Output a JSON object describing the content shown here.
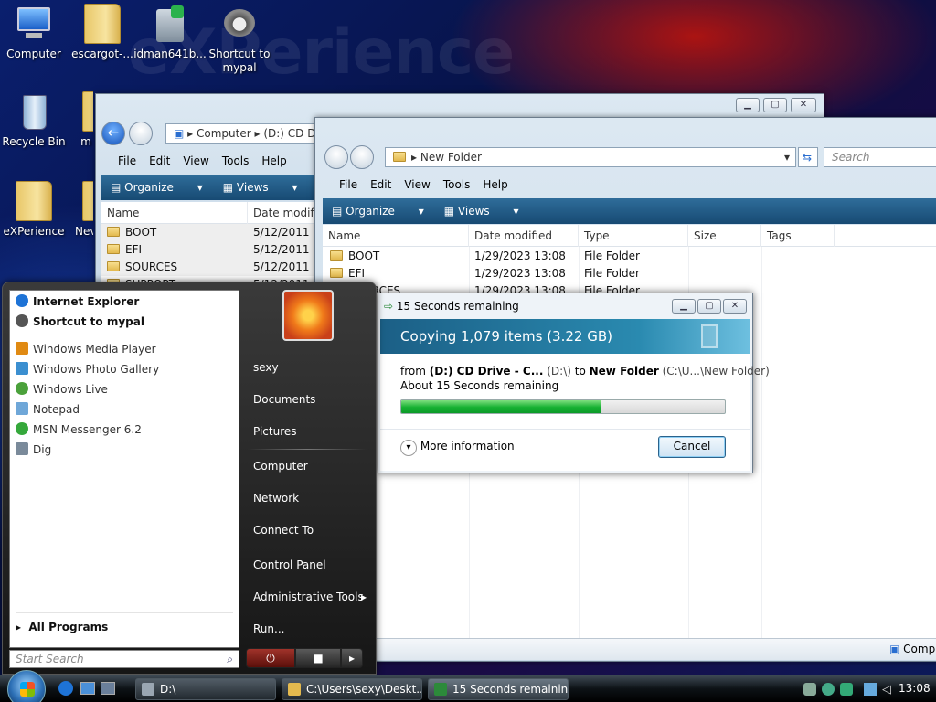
{
  "desktop": {
    "watermark": "eXPerience",
    "icons": [
      {
        "label": "Computer",
        "icon": "computer-icon"
      },
      {
        "label": "escargot-...",
        "icon": "folder-icon"
      },
      {
        "label": "idman641b...",
        "icon": "installer-icon"
      },
      {
        "label": "Shortcut to mypal",
        "icon": "raccoon-icon"
      },
      {
        "label": "Recycle Bin",
        "icon": "recycle-bin-icon"
      },
      {
        "label": "m",
        "icon": "folder-icon"
      },
      {
        "label": "eXPerience",
        "icon": "folder-icon"
      },
      {
        "label": "Nev",
        "icon": "folder-icon"
      }
    ]
  },
  "win1": {
    "address": [
      "Computer",
      "(D:) CD D"
    ],
    "menu": [
      "File",
      "Edit",
      "View",
      "Tools",
      "Help"
    ],
    "cmd": [
      "Organize",
      "Views"
    ],
    "cols": [
      "Name",
      "Date modifie"
    ],
    "rows": [
      {
        "name": "BOOT",
        "date": "5/12/2011 11"
      },
      {
        "name": "EFI",
        "date": "5/12/2011 11"
      },
      {
        "name": "SOURCES",
        "date": "5/12/2011 11"
      },
      {
        "name": "SUPPORT",
        "date": "5/12/2011 11"
      }
    ]
  },
  "win2": {
    "address": "New Folder",
    "search_placeholder": "Search",
    "menu": [
      "File",
      "Edit",
      "View",
      "Tools",
      "Help"
    ],
    "cmd": [
      "Organize",
      "Views"
    ],
    "cols": [
      "Name",
      "Date modified",
      "Type",
      "Size",
      "Tags"
    ],
    "rows": [
      {
        "name": "BOOT",
        "date": "1/29/2023 13:08",
        "type": "File Folder"
      },
      {
        "name": "EFI",
        "date": "1/29/2023 13:08",
        "type": "File Folder"
      },
      {
        "name": "SOURCES",
        "date": "1/29/2023 13:08",
        "type": "File Folder"
      }
    ],
    "status": "Comp"
  },
  "copy": {
    "title": "15 Seconds remaining",
    "heading": "Copying 1,079 items (3.22 GB)",
    "from_label": "from",
    "src": "(D:) CD Drive - C...",
    "src_path": "(D:\\)",
    "to_label": "to",
    "dst": "New Folder",
    "dst_path": "(C:\\U...\\New Folder)",
    "remaining": "About 15 Seconds remaining",
    "progress": 0.62,
    "more": "More information",
    "cancel": "Cancel"
  },
  "start": {
    "pinned": [
      {
        "label": "Internet Explorer",
        "icon": "ie-icon",
        "color": "#1e73d6"
      },
      {
        "label": "Shortcut to mypal",
        "icon": "raccoon-icon",
        "color": "#555"
      }
    ],
    "recent": [
      {
        "label": "Windows Media Player",
        "icon": "media-player-icon",
        "color": "#e08a13"
      },
      {
        "label": "Windows Photo Gallery",
        "icon": "photo-gallery-icon",
        "color": "#3b8fd0"
      },
      {
        "label": "Windows Live",
        "icon": "windows-live-icon",
        "color": "#4ba13b"
      },
      {
        "label": "Notepad",
        "icon": "notepad-icon",
        "color": "#6fa7d8"
      },
      {
        "label": "MSN Messenger 6.2",
        "icon": "msn-icon",
        "color": "#35a83b"
      },
      {
        "label": "Dig",
        "icon": "dig-icon",
        "color": "#7a8a9a"
      }
    ],
    "all_programs": "All Programs",
    "search_placeholder": "Start Search",
    "right": [
      "sexy",
      "Documents",
      "Pictures",
      "Computer",
      "Network",
      "Connect To",
      "Control Panel",
      "Administrative Tools",
      "Run..."
    ]
  },
  "taskbar": {
    "buttons": [
      "D:\\",
      "C:\\Users\\sexy\\Deskt...",
      "15 Seconds remaining"
    ],
    "clock": "13:08"
  }
}
